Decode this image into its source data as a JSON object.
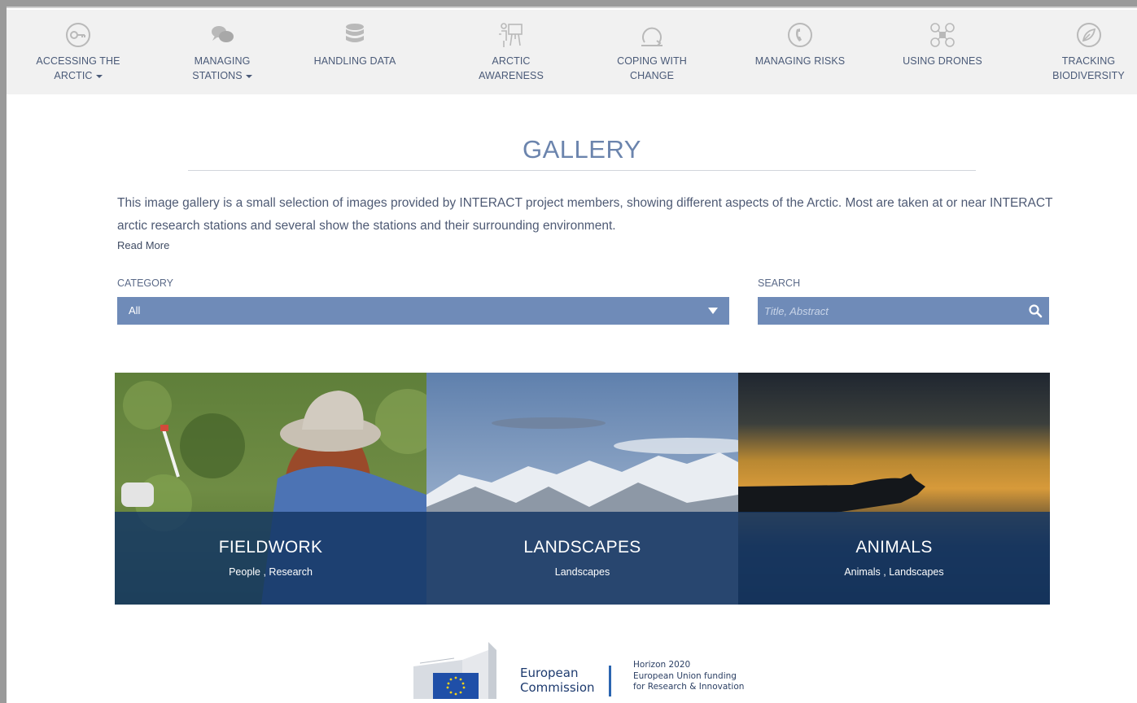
{
  "nav": {
    "items": [
      {
        "line1": "ACCESSING THE",
        "line2": "ARCTIC",
        "icon": "key-icon"
      },
      {
        "line1": "MANAGING",
        "line2": "STATIONS",
        "icon": "chat-bubbles-icon"
      },
      {
        "line1": "HANDLING DATA",
        "line2": "",
        "icon": "database-icon"
      },
      {
        "line1": "ARCTIC",
        "line2": "AWARENESS",
        "icon": "presentation-icon"
      },
      {
        "line1": "COPING WITH",
        "line2": "CHANGE",
        "icon": "loop-arrow-icon"
      },
      {
        "line1": "MANAGING RISKS",
        "line2": "",
        "icon": "phone-icon"
      },
      {
        "line1": "USING DRONES",
        "line2": "",
        "icon": "drone-icon"
      },
      {
        "line1": "TRACKING",
        "line2": "BIODIVERSITY",
        "icon": "leaf-icon"
      }
    ]
  },
  "gallery": {
    "title": "GALLERY",
    "intro": "This image gallery is a small selection of images provided by INTERACT project members, showing different aspects of the Arctic. Most are taken at or near INTERACT arctic research stations and several show the stations and their surrounding environment.",
    "read_more": "Read More"
  },
  "filters": {
    "category_label": "CATEGORY",
    "category_value": "All",
    "search_label": "SEARCH",
    "search_placeholder": "Title, Abstract"
  },
  "cards": [
    {
      "title": "FIELDWORK",
      "subtitle": "People , Research"
    },
    {
      "title": "LANDSCAPES",
      "subtitle": "Landscapes"
    },
    {
      "title": "ANIMALS",
      "subtitle": "Animals , Landscapes"
    }
  ],
  "footer": {
    "ec_line1": "European",
    "ec_line2": "Commission",
    "h2020_line1": "Horizon 2020",
    "h2020_line2": "European Union funding",
    "h2020_line3": "for Research & Innovation"
  },
  "colors": {
    "accent": "#6f8bb8",
    "overlay": "#143764",
    "text": "#4a5a78"
  }
}
